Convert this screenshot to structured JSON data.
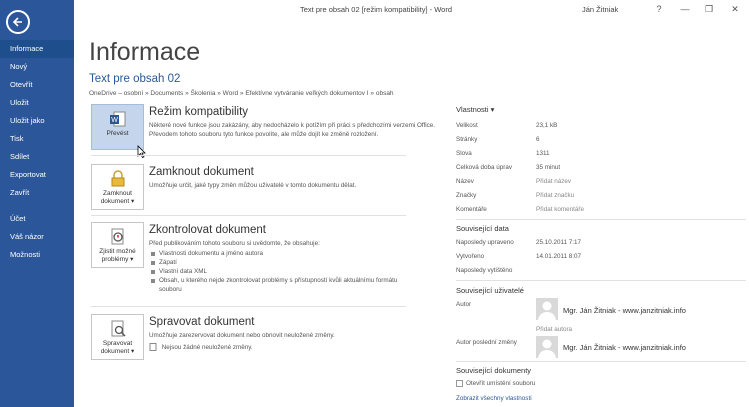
{
  "window": {
    "title": "Text pre obsah 02 [režim kompatibility] - Word",
    "user": "Ján Žitniak",
    "controls": [
      "?",
      "—",
      "❐",
      "✕"
    ]
  },
  "sidebar": {
    "items": [
      {
        "label": "Informace",
        "active": true
      },
      {
        "label": "Nový"
      },
      {
        "label": "Otevřít"
      },
      {
        "label": "Uložit"
      },
      {
        "label": "Uložit jako"
      },
      {
        "label": "Tisk"
      },
      {
        "label": "Sdílet"
      },
      {
        "label": "Exportovat"
      },
      {
        "label": "Zavřít"
      }
    ],
    "bottom_items": [
      {
        "label": "Účet"
      },
      {
        "label": "Váš názor"
      },
      {
        "label": "Možnosti"
      }
    ]
  },
  "main": {
    "title": "Informace",
    "doc_title": "Text pre obsah 02",
    "breadcrumb": "OneDrive – osobní » Documents » Školenia » Word » Efektívne vytváranie veľkých dokumentov I » obsah"
  },
  "sections": {
    "compat": {
      "button": "Převést",
      "heading": "Režim kompatibility",
      "text": "Některé nové funkce jsou zakázány, aby nedocházelo k potížím při práci s předchozími verzemi Office. Převodem tohoto souboru tyto funkce povolíte, ale může dojít ke změně rozložení."
    },
    "protect": {
      "button_line1": "Zamknout",
      "button_line2": "dokument ▾",
      "heading": "Zamknout dokument",
      "text": "Umožňuje určit, jaké typy změn můžou uživatelé v tomto dokumentu dělat."
    },
    "inspect": {
      "button_line1": "Zjistit možné",
      "button_line2": "problémy ▾",
      "heading": "Zkontrolovat dokument",
      "text": "Před publikováním tohoto souboru si uvědomte, že obsahuje:",
      "bullets": [
        "Vlastnosti dokumentu a jméno autora",
        "Zápatí",
        "Vlastní data XML",
        "Obsah, u kterého nejde zkontrolovat problémy s přístupností kvůli aktuálnímu formátu souboru"
      ]
    },
    "manage": {
      "button_line1": "Spravovat",
      "button_line2": "dokument ▾",
      "heading": "Spravovat dokument",
      "text": "Umožňuje zarezervovat dokument nebo obnovit neuložené změny.",
      "note": "Nejsou žádné neuložené změny."
    }
  },
  "properties": {
    "heading": "Vlastnosti ▾",
    "rows": [
      {
        "label": "Velikost",
        "value": "23,1 kB"
      },
      {
        "label": "Stránky",
        "value": "6"
      },
      {
        "label": "Slova",
        "value": "1311"
      },
      {
        "label": "Celková doba úprav",
        "value": "35 minut"
      },
      {
        "label": "Název",
        "value": "Přidat název"
      },
      {
        "label": "Značky",
        "value": "Přidat značku"
      },
      {
        "label": "Komentáře",
        "value": "Přidat komentáře"
      }
    ],
    "dates_heading": "Související data",
    "dates": [
      {
        "label": "Naposledy upraveno",
        "value": "25.10.2011 7:17"
      },
      {
        "label": "Vytvořeno",
        "value": "14.01.2011 8:07"
      },
      {
        "label": "Naposledy vytištěno",
        "value": ""
      }
    ],
    "users_heading": "Související uživatelé",
    "author_label": "Autor",
    "author_name": "Mgr. Ján Žitniak - www.janzitniak.info",
    "add_author": "Přidat autora",
    "last_author_label": "Autor poslední změny",
    "last_author_name": "Mgr. Ján Žitniak - www.janzitniak.info",
    "docs_heading": "Související dokumenty",
    "open_location": "Otevřít umístění souboru",
    "show_all": "Zobrazit všechny vlastnosti"
  },
  "colors": {
    "accent": "#2b579a",
    "sidebar_active": "#1e4e8c",
    "selected_button": "#c5d6ec"
  }
}
